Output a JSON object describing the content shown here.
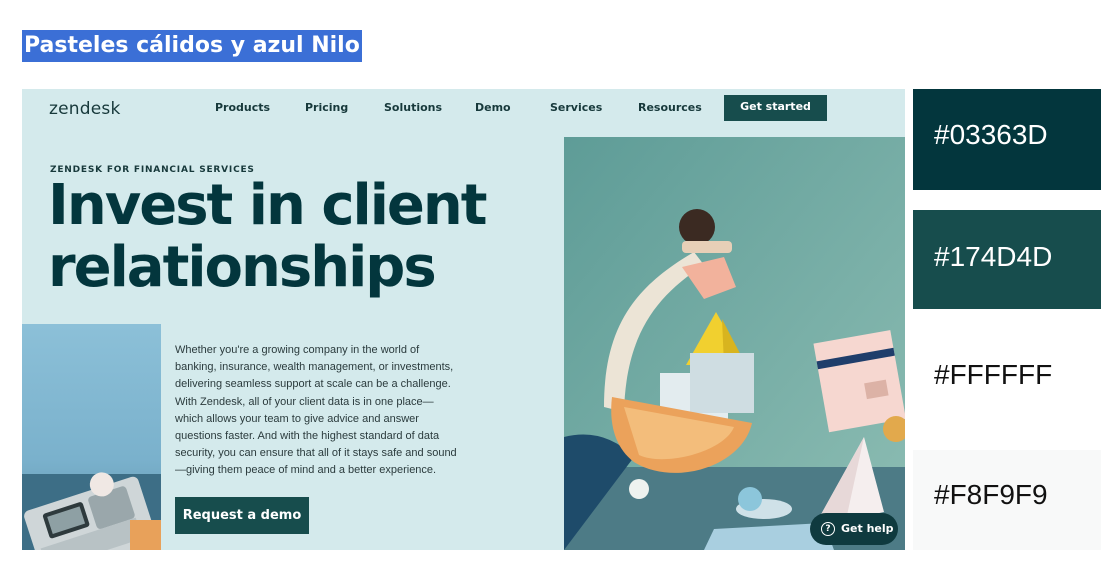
{
  "heading": "Pasteles cálidos y azul Nilo",
  "site": {
    "logo": "zendesk",
    "nav": [
      "Products",
      "Pricing",
      "Solutions",
      "Demo",
      "Services",
      "Resources"
    ],
    "cta": "Get started",
    "eyebrow": "ZENDESK FOR FINANCIAL SERVICES",
    "hero_line1": "Invest in client",
    "hero_line2": "relationships",
    "body_lines": [
      "Whether you're a growing company in the world of",
      "banking, insurance, wealth management, or investments,",
      "delivering seamless support at scale can be a challenge.",
      "With Zendesk, all of your client data is in one place—",
      "which allows your team to give advice and answer",
      "questions faster. And with the highest standard of data",
      "security, you can ensure that all of it stays safe and sound",
      "—giving them peace of mind and a better experience."
    ],
    "demo_button": "Request a demo",
    "help_button": "Get help",
    "help_glyph": "?"
  },
  "palette": [
    {
      "hex": "#03363D",
      "color": "#03363d",
      "text_color": "#ffffff"
    },
    {
      "hex": "#174D4D",
      "color": "#174d4d",
      "text_color": "#ffffff"
    },
    {
      "hex": "#FFFFFF",
      "color": "#ffffff",
      "text_color": "#111111"
    },
    {
      "hex": "#F8F9F9",
      "color": "#f8f9f9",
      "text_color": "#111111"
    }
  ],
  "colors": {
    "heading_bg": "#3b6fd6",
    "page_bg": "#d4eaec",
    "accent": "#174d4d"
  }
}
